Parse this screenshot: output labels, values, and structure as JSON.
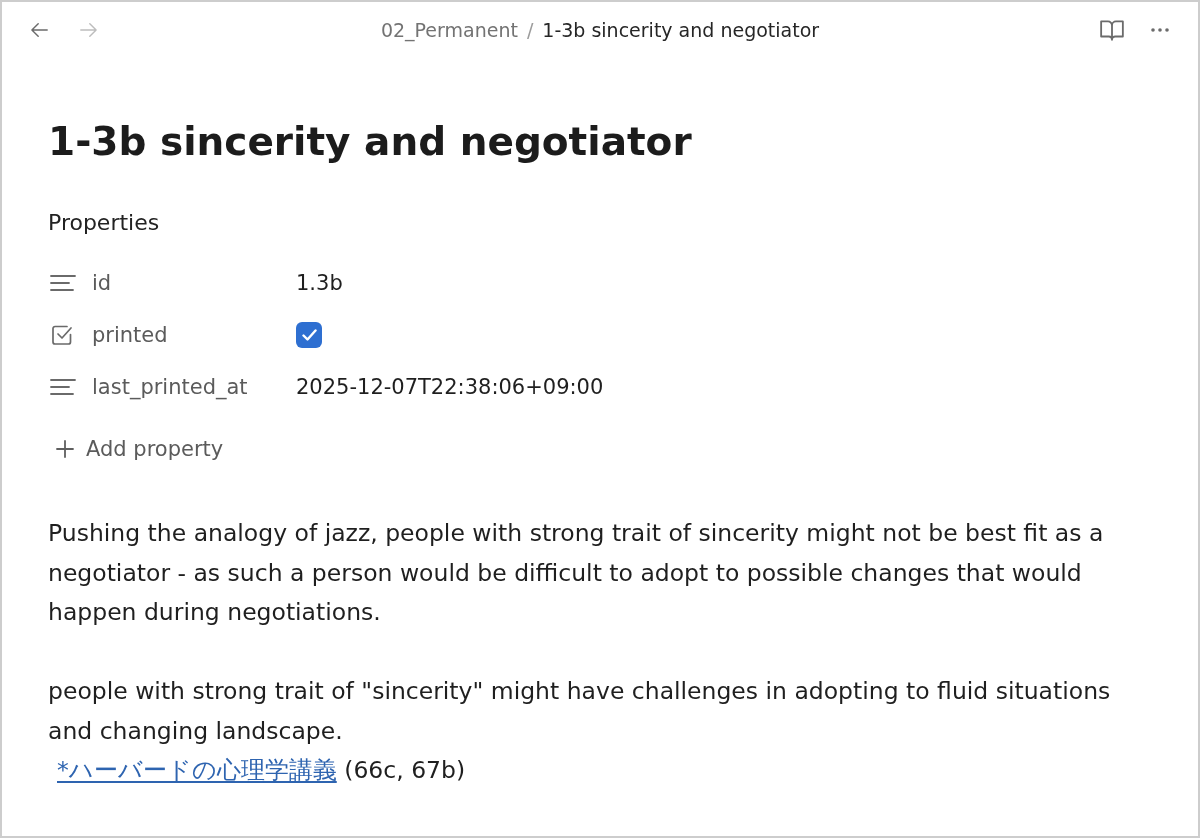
{
  "header": {
    "nav": [
      {
        "kind": "back",
        "disabled": false
      },
      {
        "kind": "forward",
        "disabled": true
      }
    ],
    "breadcrumb": [
      {
        "label": "02_Permanent",
        "current": false
      },
      {
        "label": "1-3b sincerity and negotiator",
        "current": true
      }
    ],
    "separator": "/"
  },
  "note": {
    "title": "1-3b sincerity and negotiator",
    "properties": {
      "heading": "Properties",
      "items": [
        {
          "kind": "text",
          "name": "id",
          "value": "1.3b"
        },
        {
          "kind": "checkbox",
          "name": "printed",
          "checked": true
        },
        {
          "kind": "text",
          "name": "last_printed_at",
          "value": "2025-12-07T22:38:06+09:00"
        }
      ],
      "add_label": "Add property"
    },
    "paragraphs": [
      "Pushing the analogy of jazz, people with strong trait of sincerity might not be best fit as a negotiator - as such a person would be difficult to adopt to possible changes that would happen during negotiations.",
      "people with strong trait of \"sincerity\" might have challenges in adopting to fluid situations and changing landscape."
    ],
    "citation": {
      "link": "*ハーバードの心理学講義",
      "text": "(66c, 67b)"
    }
  }
}
